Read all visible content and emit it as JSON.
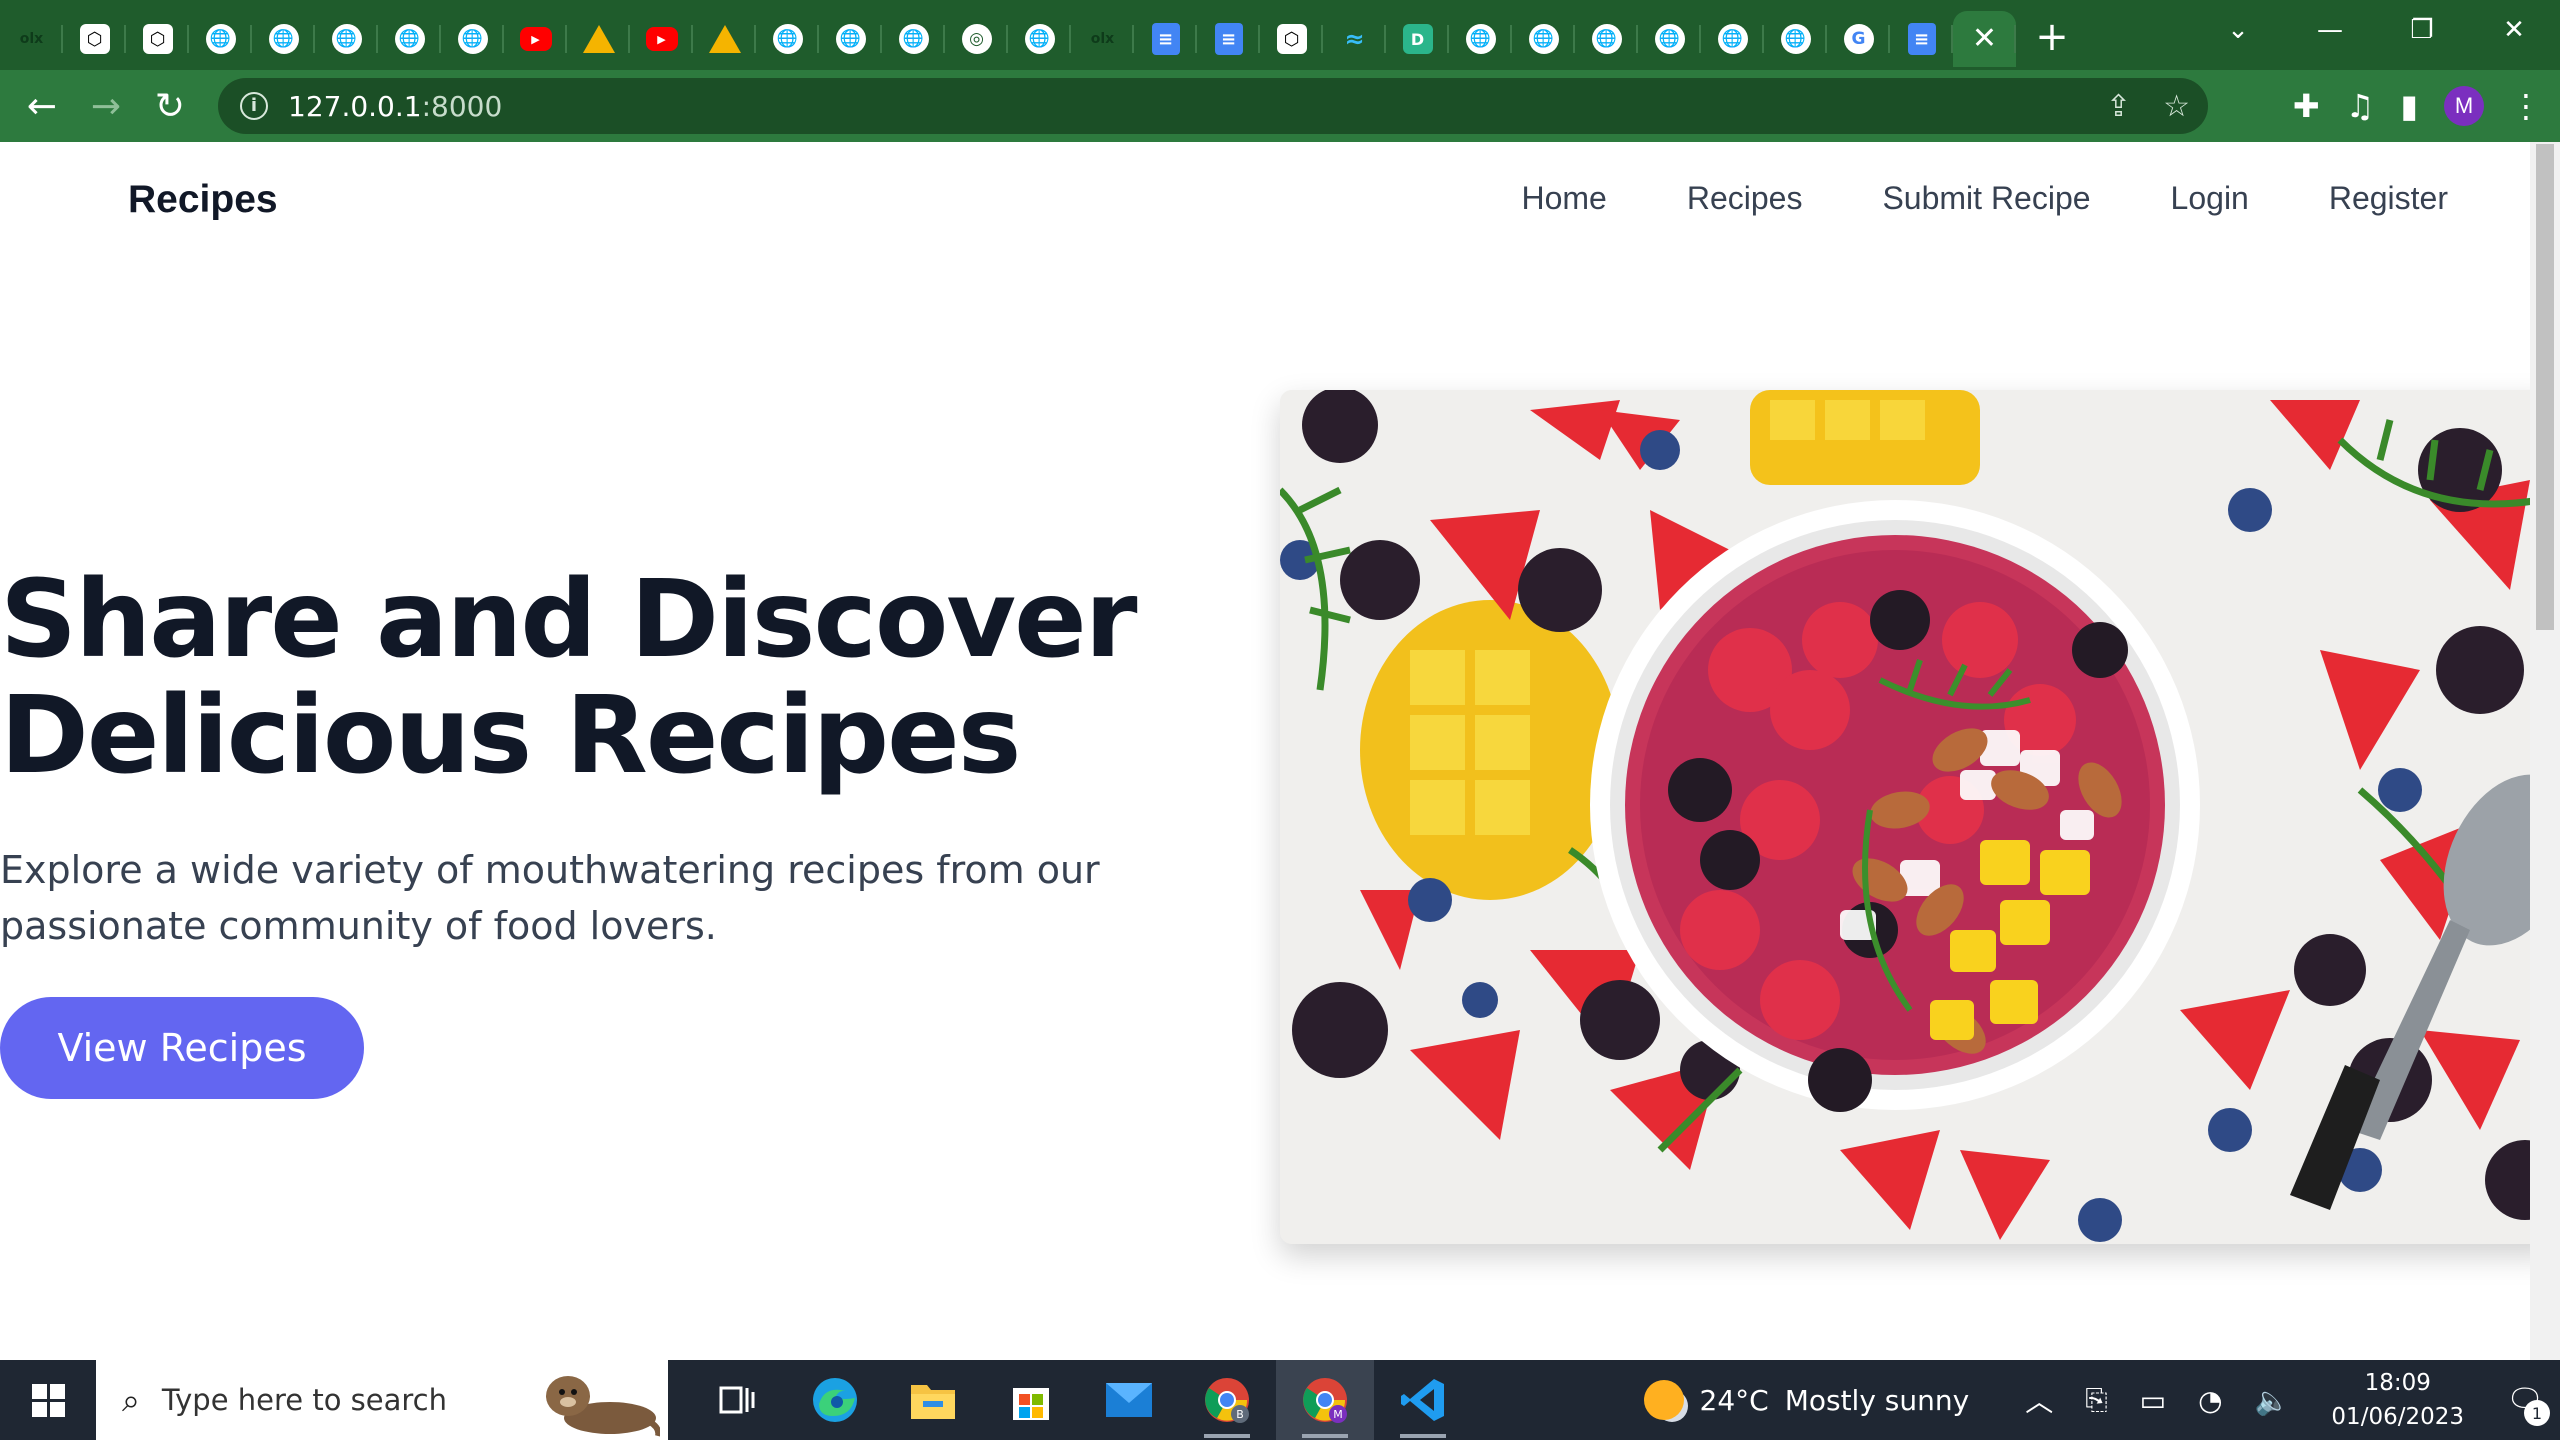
{
  "browser": {
    "tabs": [
      {
        "icon": "olx-icon",
        "glyph": "olx"
      },
      {
        "icon": "codepen-icon",
        "glyph": "⬡"
      },
      {
        "icon": "codepen-icon",
        "glyph": "⬡"
      },
      {
        "icon": "globe-icon",
        "glyph": "🌐"
      },
      {
        "icon": "globe-icon",
        "glyph": "🌐"
      },
      {
        "icon": "globe-icon",
        "glyph": "🌐"
      },
      {
        "icon": "globe-icon",
        "glyph": "🌐"
      },
      {
        "icon": "globe-icon",
        "glyph": "🌐"
      },
      {
        "icon": "youtube-icon",
        "glyph": "▶"
      },
      {
        "icon": "google-drive-icon",
        "glyph": ""
      },
      {
        "icon": "youtube-icon",
        "glyph": "▶"
      },
      {
        "icon": "google-drive-icon",
        "glyph": ""
      },
      {
        "icon": "globe-icon",
        "glyph": "🌐"
      },
      {
        "icon": "globe-icon",
        "glyph": "🌐"
      },
      {
        "icon": "globe-icon",
        "glyph": "🌐"
      },
      {
        "icon": "chrome-icon",
        "glyph": "◎"
      },
      {
        "icon": "globe-icon",
        "glyph": "🌐"
      },
      {
        "icon": "olx-icon",
        "glyph": "olx"
      },
      {
        "icon": "google-docs-icon",
        "glyph": "≡"
      },
      {
        "icon": "google-docs-icon",
        "glyph": "≡"
      },
      {
        "icon": "codepen-icon",
        "glyph": "⬡"
      },
      {
        "icon": "tailwind-icon",
        "glyph": "≈"
      },
      {
        "icon": "d-icon",
        "glyph": "D"
      },
      {
        "icon": "globe-icon",
        "glyph": "🌐"
      },
      {
        "icon": "globe-icon",
        "glyph": "🌐"
      },
      {
        "icon": "globe-icon",
        "glyph": "🌐"
      },
      {
        "icon": "globe-icon",
        "glyph": "🌐"
      },
      {
        "icon": "globe-icon",
        "glyph": "🌐"
      },
      {
        "icon": "globe-icon",
        "glyph": "🌐"
      },
      {
        "icon": "google-icon",
        "glyph": "G"
      },
      {
        "icon": "google-docs-icon",
        "glyph": "≡"
      }
    ],
    "active_tab_close": "✕",
    "new_tab": "+",
    "url_host": "127.0.0.1",
    "url_port": ":8000",
    "profile_initial": "M",
    "accent_color": "#2d7a3e"
  },
  "site": {
    "brand": "Recipes",
    "nav": [
      "Home",
      "Recipes",
      "Submit Recipe",
      "Login",
      "Register"
    ],
    "hero": {
      "title": "Share and Discover Delicious Recipes",
      "subtitle": "Explore a wide variety of mouthwatering recipes from our passionate community of food lovers.",
      "cta": "View Recipes",
      "cta_color": "#6366f1"
    }
  },
  "taskbar": {
    "search_placeholder": "Type here to search",
    "weather_temp": "24°C",
    "weather_desc": "Mostly sunny",
    "time": "18:09",
    "date": "01/06/2023",
    "notification_count": "1"
  }
}
